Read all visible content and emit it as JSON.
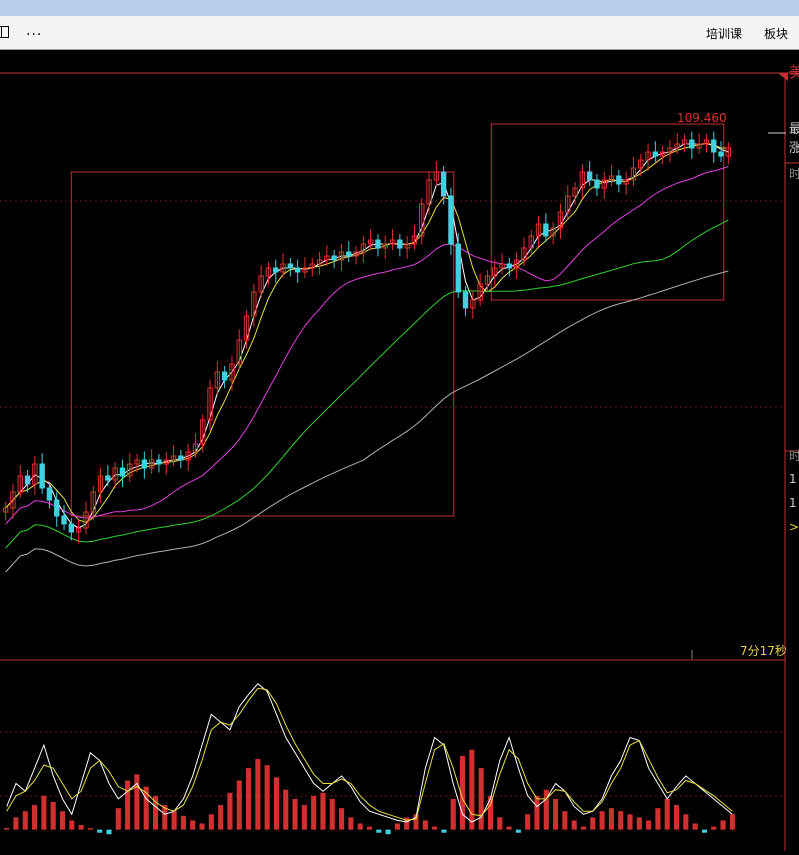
{
  "toolbar": {
    "more_label": "...",
    "training_label": "培训课",
    "sector_label": "板块"
  },
  "side_panel": {
    "top_char": "美",
    "chars": [
      "最",
      "涨"
    ],
    "section_labels": [
      "时",
      "时"
    ],
    "rows": [
      "1",
      "1",
      ">1"
    ]
  },
  "colors": {
    "background": "#000000",
    "frame": "#c03030",
    "up": "#e03030",
    "down": "#40d0e0",
    "ma_short": "#ffffff",
    "ma_mid": "#e8e040",
    "ma_long": "#e040e0",
    "ma_longer": "#30d030",
    "ma_longest": "#b0b0b0",
    "macd_pos": "#d03030",
    "macd_neg": "#40d0e0",
    "kline_high_label": "#e03030",
    "timer_text": "#e8d048"
  },
  "chart_data": [
    {
      "type": "candlestick",
      "price_high_label": "109.460",
      "timer_label": "7分17秒",
      "x_range": [
        0,
        100
      ],
      "y_range": [
        0,
        100
      ],
      "close": [
        14,
        18,
        22,
        20,
        25,
        19,
        16,
        12,
        10,
        8,
        9,
        13,
        18,
        22,
        21,
        24,
        22,
        25,
        26,
        24,
        26,
        25,
        26,
        27,
        26,
        28,
        30,
        36,
        44,
        48,
        46,
        50,
        56,
        62,
        68,
        72,
        74,
        73,
        75,
        74,
        73,
        74,
        75,
        76,
        77,
        76,
        78,
        77,
        78,
        80,
        81,
        79,
        80,
        81,
        79,
        80,
        82,
        90,
        96,
        98,
        92,
        80,
        68,
        64,
        66,
        70,
        72,
        74,
        75,
        74,
        76,
        79,
        82,
        85,
        82,
        84,
        88,
        92,
        94,
        98,
        96,
        94,
        96,
        97,
        95,
        96,
        99,
        101,
        103,
        102,
        103,
        104,
        105,
        106,
        104,
        105,
        106,
        103,
        102,
        104
      ],
      "rects": [
        {
          "x1": 9.5,
          "x2": 60.5,
          "y_top": 98,
          "y_bottom": 12
        },
        {
          "x1": 65.5,
          "x2": 96.5,
          "y_top": 110,
          "y_bottom": 66
        }
      ],
      "ma_periods": [
        "short",
        "mid",
        "long",
        "longer",
        "longest"
      ]
    },
    {
      "type": "oscillator",
      "y_range": [
        -10,
        100
      ],
      "k": [
        15,
        30,
        25,
        40,
        55,
        35,
        20,
        10,
        30,
        50,
        45,
        30,
        20,
        25,
        30,
        20,
        15,
        10,
        12,
        20,
        35,
        55,
        75,
        70,
        65,
        80,
        88,
        95,
        90,
        75,
        60,
        50,
        40,
        30,
        25,
        30,
        35,
        28,
        18,
        12,
        10,
        8,
        6,
        5,
        8,
        40,
        60,
        55,
        30,
        10,
        5,
        8,
        20,
        45,
        60,
        40,
        22,
        15,
        20,
        30,
        25,
        15,
        10,
        12,
        20,
        35,
        45,
        60,
        58,
        40,
        30,
        20,
        28,
        35,
        30,
        25,
        20,
        15,
        10
      ],
      "d": [
        12,
        22,
        25,
        32,
        42,
        40,
        30,
        20,
        25,
        40,
        45,
        38,
        28,
        25,
        28,
        24,
        18,
        14,
        12,
        16,
        28,
        45,
        65,
        70,
        68,
        75,
        84,
        92,
        91,
        82,
        68,
        56,
        46,
        36,
        30,
        30,
        33,
        30,
        22,
        16,
        12,
        10,
        8,
        6,
        7,
        30,
        52,
        56,
        40,
        20,
        10,
        9,
        16,
        36,
        52,
        46,
        30,
        20,
        20,
        26,
        25,
        18,
        12,
        12,
        18,
        30,
        40,
        55,
        58,
        46,
        34,
        24,
        26,
        32,
        30,
        26,
        22,
        17,
        12
      ],
      "macd": [
        1,
        8,
        12,
        16,
        22,
        18,
        12,
        6,
        3,
        1,
        -2,
        -3,
        14,
        32,
        36,
        28,
        22,
        16,
        12,
        9,
        6,
        4,
        10,
        16,
        24,
        32,
        40,
        46,
        42,
        34,
        26,
        20,
        16,
        22,
        24,
        20,
        14,
        8,
        4,
        2,
        -2,
        -3,
        4,
        8,
        10,
        6,
        2,
        -2,
        20,
        48,
        52,
        40,
        22,
        8,
        2,
        -2,
        10,
        22,
        26,
        20,
        12,
        6,
        2,
        8,
        12,
        14,
        12,
        10,
        8,
        6,
        14,
        20,
        16,
        10,
        4,
        -2,
        2,
        6,
        10
      ]
    }
  ]
}
